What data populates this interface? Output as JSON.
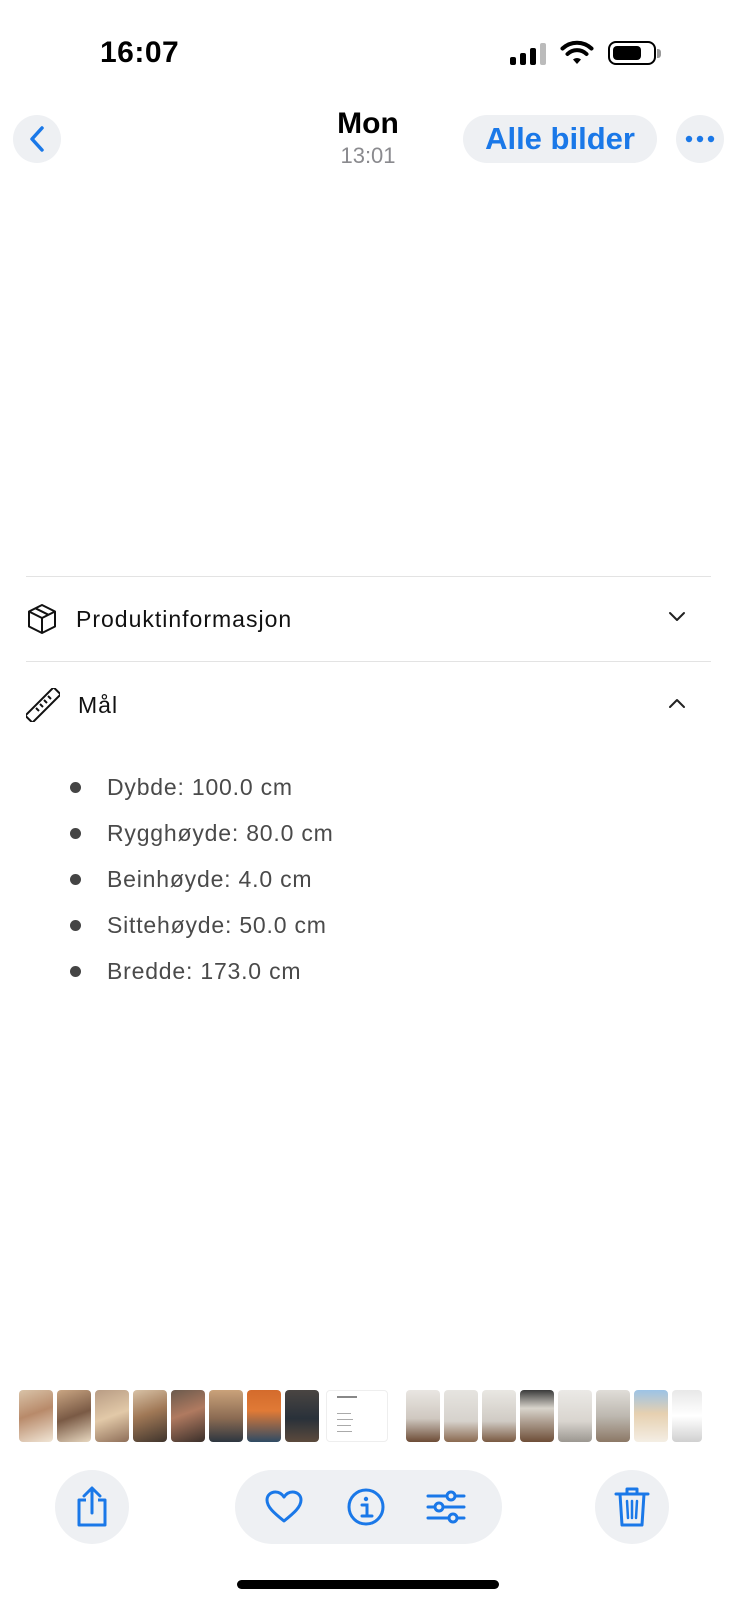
{
  "status_bar": {
    "time": "16:07"
  },
  "nav": {
    "title": "Mon",
    "subtitle": "13:01",
    "all_photos_label": "Alle bilder"
  },
  "photo": {
    "sections": [
      {
        "label": "Produktinformasjon",
        "icon": "box-icon",
        "expanded": false
      },
      {
        "label": "Mål",
        "icon": "ruler-icon",
        "expanded": true
      }
    ],
    "measurements": [
      "Dybde: 100.0 cm",
      "Rygghøyde: 80.0 cm",
      "Beinhøyde: 4.0 cm",
      "Sittehøyde: 50.0 cm",
      "Bredde: 173.0 cm"
    ]
  },
  "filmstrip": {
    "count": 19,
    "selected_index": 8
  },
  "toolbar": {
    "icons": [
      "share-icon",
      "heart-icon",
      "info-icon",
      "sliders-icon",
      "trash-icon"
    ]
  },
  "colors": {
    "accent": "#1a78e8",
    "button_bg": "#eef0f3"
  }
}
